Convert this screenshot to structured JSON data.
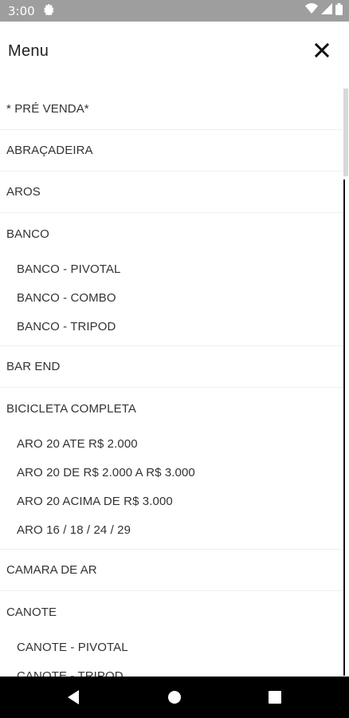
{
  "status_bar": {
    "time": "3:00",
    "icons": [
      "settings-gear-icon",
      "wifi-icon",
      "signal-icon",
      "battery-icon"
    ]
  },
  "header": {
    "title": "Menu",
    "close_icon": "close-icon"
  },
  "menu": {
    "items": [
      {
        "label": "* PRÉ VENDA*"
      },
      {
        "label": "ABRAÇADEIRA"
      },
      {
        "label": "AROS"
      },
      {
        "label": "BANCO",
        "children": [
          "BANCO - PIVOTAL",
          "BANCO - COMBO",
          "BANCO - TRIPOD"
        ]
      },
      {
        "label": "BAR END"
      },
      {
        "label": "BICICLETA COMPLETA",
        "children": [
          "ARO 20 ATE R$ 2.000",
          "ARO 20 DE R$ 2.000 A R$ 3.000",
          "ARO 20 ACIMA DE R$ 3.000",
          "ARO 16 / 18 / 24 / 29"
        ]
      },
      {
        "label": "CAMARA DE AR"
      },
      {
        "label": "CANOTE",
        "children": [
          "CANOTE - PIVOTAL",
          "CANOTE - TRIPOD"
        ]
      }
    ]
  },
  "nav_bar": {
    "back_icon": "back-triangle-icon",
    "home_icon": "home-circle-icon",
    "recents_icon": "recents-square-icon"
  },
  "colors": {
    "status_bar_bg": "#9e9e9e",
    "nav_bar_bg": "#000000",
    "text": "#333333",
    "divider": "#f0f0f0"
  }
}
